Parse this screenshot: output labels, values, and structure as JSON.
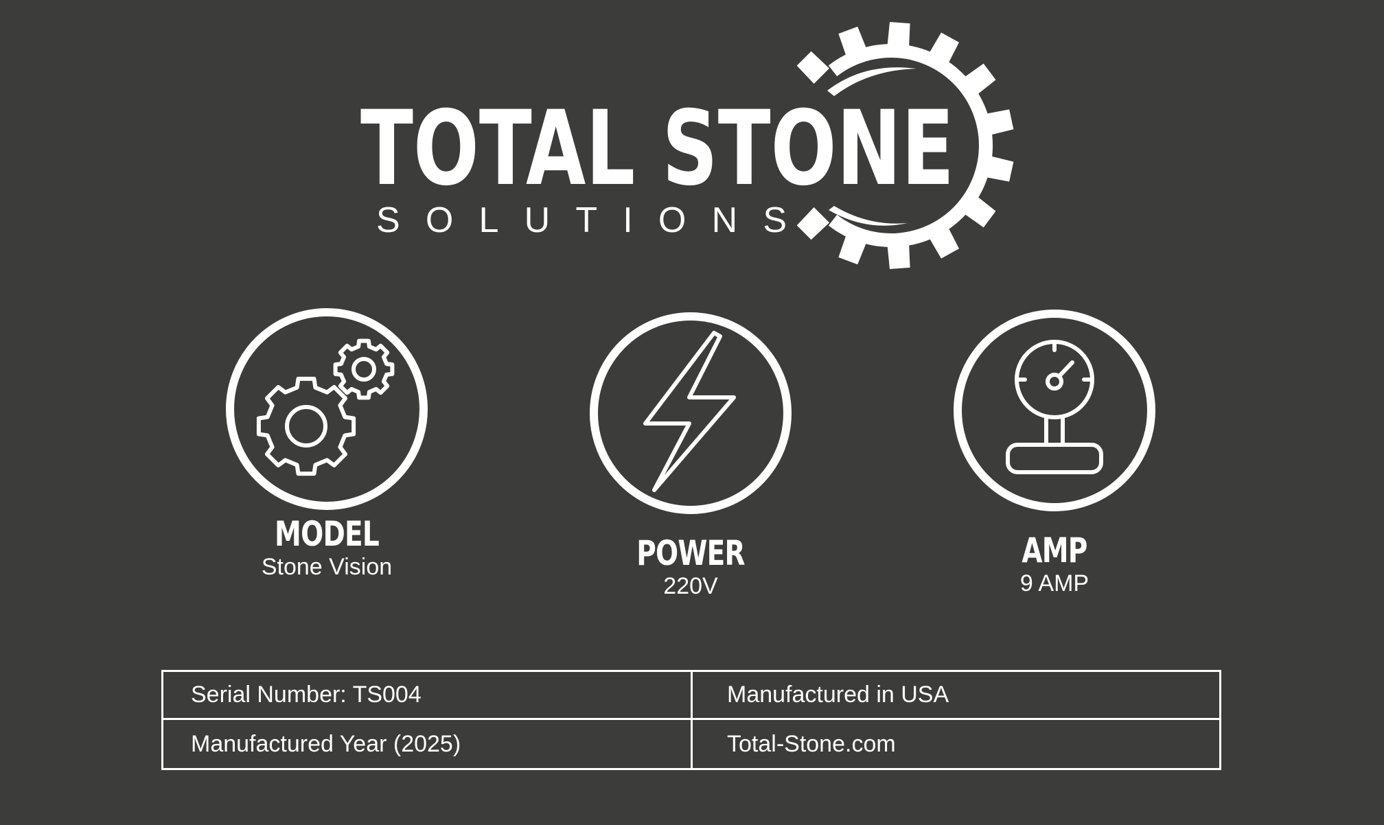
{
  "brand": {
    "name_line1": "TOTAL STONE",
    "name_line2": "SOLUTIONS",
    "logo_icon": "gear-icon"
  },
  "specs": [
    {
      "title": "MODEL",
      "value": "Stone Vision",
      "icon": "gears-icon"
    },
    {
      "title": "POWER",
      "value": "220V",
      "icon": "lightning-bolt-icon"
    },
    {
      "title": "AMP",
      "value": "9 AMP",
      "icon": "pressure-gauge-icon"
    }
  ],
  "info_table": {
    "rows": [
      [
        "Serial Number: TS004",
        "Manufactured in USA"
      ],
      [
        "Manufactured Year (2025)",
        "Total-Stone.com"
      ]
    ]
  },
  "colors": {
    "background": "#3c3c3b",
    "foreground": "#ffffff"
  }
}
